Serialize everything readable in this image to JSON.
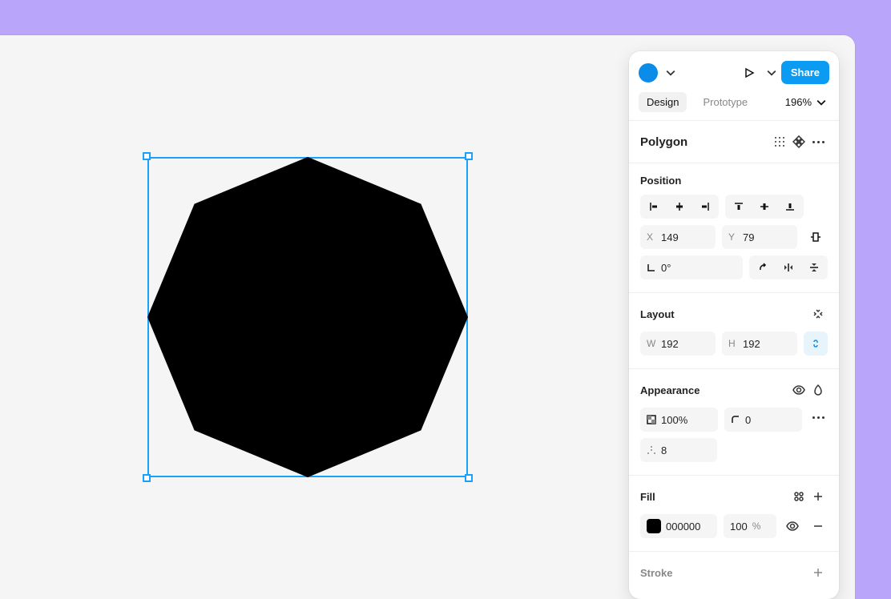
{
  "toolbar": {
    "share_label": "Share",
    "tabs": {
      "design": "Design",
      "prototype": "Prototype"
    },
    "zoom": "196%"
  },
  "layer": {
    "name": "Polygon"
  },
  "position": {
    "title": "Position",
    "x": "149",
    "y": "79",
    "rotation": "0°"
  },
  "layout": {
    "title": "Layout",
    "w": "192",
    "h": "192"
  },
  "appearance": {
    "title": "Appearance",
    "opacity": "100%",
    "corner": "0",
    "sides": "8"
  },
  "fill": {
    "title": "Fill",
    "hex": "000000",
    "opacity": "100",
    "opacity_unit": "%"
  },
  "stroke": {
    "title": "Stroke"
  }
}
